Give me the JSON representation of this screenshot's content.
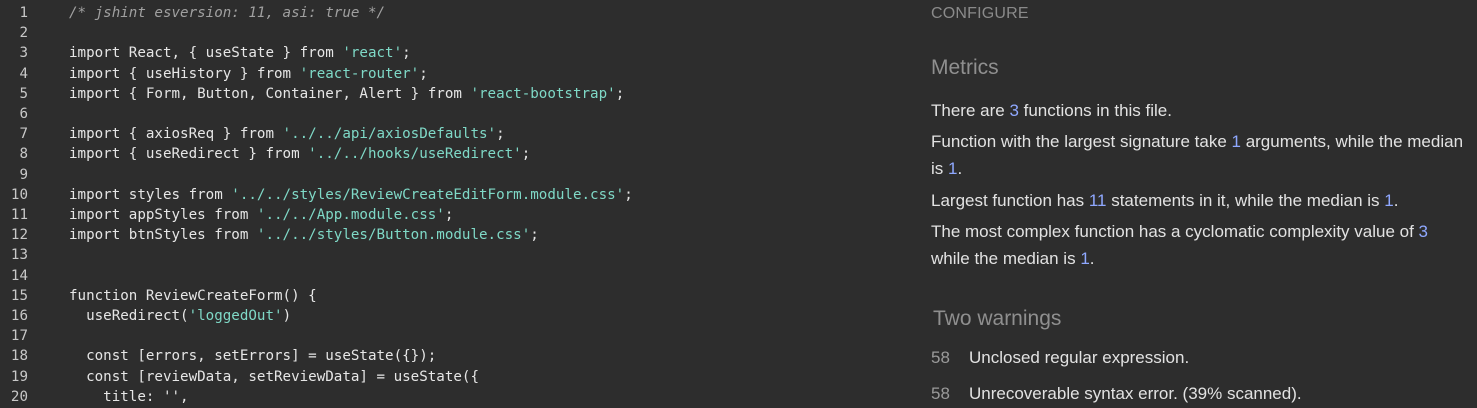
{
  "editor": {
    "lines": [
      {
        "n": "1",
        "t": [
          {
            "k": "comment",
            "v": "/* jshint esversion: 11, asi: true */"
          }
        ]
      },
      {
        "n": "2",
        "t": []
      },
      {
        "n": "3",
        "t": [
          {
            "k": "plain",
            "v": "import React, { useState } from "
          },
          {
            "k": "string",
            "v": "'react'"
          },
          {
            "k": "plain",
            "v": ";"
          }
        ]
      },
      {
        "n": "4",
        "t": [
          {
            "k": "plain",
            "v": "import { useHistory } from "
          },
          {
            "k": "string",
            "v": "'react-router'"
          },
          {
            "k": "plain",
            "v": ";"
          }
        ]
      },
      {
        "n": "5",
        "t": [
          {
            "k": "plain",
            "v": "import { Form, Button, Container, Alert } from "
          },
          {
            "k": "string",
            "v": "'react-bootstrap'"
          },
          {
            "k": "plain",
            "v": ";"
          }
        ]
      },
      {
        "n": "6",
        "t": []
      },
      {
        "n": "7",
        "t": [
          {
            "k": "plain",
            "v": "import { axiosReq } from "
          },
          {
            "k": "string",
            "v": "'../../api/axiosDefaults'"
          },
          {
            "k": "plain",
            "v": ";"
          }
        ]
      },
      {
        "n": "8",
        "t": [
          {
            "k": "plain",
            "v": "import { useRedirect } from "
          },
          {
            "k": "string",
            "v": "'../../hooks/useRedirect'"
          },
          {
            "k": "plain",
            "v": ";"
          }
        ]
      },
      {
        "n": "9",
        "t": []
      },
      {
        "n": "10",
        "t": [
          {
            "k": "plain",
            "v": "import styles from "
          },
          {
            "k": "string",
            "v": "'../../styles/ReviewCreateEditForm.module.css'"
          },
          {
            "k": "plain",
            "v": ";"
          }
        ]
      },
      {
        "n": "11",
        "t": [
          {
            "k": "plain",
            "v": "import appStyles from "
          },
          {
            "k": "string",
            "v": "'../../App.module.css'"
          },
          {
            "k": "plain",
            "v": ";"
          }
        ]
      },
      {
        "n": "12",
        "t": [
          {
            "k": "plain",
            "v": "import btnStyles from "
          },
          {
            "k": "string",
            "v": "'../../styles/Button.module.css'"
          },
          {
            "k": "plain",
            "v": ";"
          }
        ]
      },
      {
        "n": "13",
        "t": []
      },
      {
        "n": "14",
        "t": []
      },
      {
        "n": "15",
        "t": [
          {
            "k": "plain",
            "v": "function ReviewCreateForm() {"
          }
        ]
      },
      {
        "n": "16",
        "t": [
          {
            "k": "plain",
            "v": "  useRedirect("
          },
          {
            "k": "string",
            "v": "'loggedOut'"
          },
          {
            "k": "plain",
            "v": ")"
          }
        ]
      },
      {
        "n": "17",
        "t": []
      },
      {
        "n": "18",
        "t": [
          {
            "k": "plain",
            "v": "  const [errors, setErrors] = useState({});"
          }
        ]
      },
      {
        "n": "19",
        "t": [
          {
            "k": "plain",
            "v": "  const [reviewData, setReviewData] = useState({"
          }
        ]
      },
      {
        "n": "20",
        "t": [
          {
            "k": "plain",
            "v": "    title: '',"
          }
        ]
      }
    ]
  },
  "panel": {
    "configure_label": "CONFIGURE",
    "metrics_title": "Metrics",
    "metrics": [
      [
        {
          "t": "There are "
        },
        {
          "n": "3"
        },
        {
          "t": " functions in this file."
        }
      ],
      [
        {
          "t": "Function with the largest signature take "
        },
        {
          "n": "1"
        },
        {
          "t": " arguments, while the median is "
        },
        {
          "n": "1"
        },
        {
          "t": "."
        }
      ],
      [
        {
          "t": "Largest function has "
        },
        {
          "n": "11"
        },
        {
          "t": " statements in it, while the median is "
        },
        {
          "n": "1"
        },
        {
          "t": "."
        }
      ],
      [
        {
          "t": "The most complex function has a cyclomatic complexity value of "
        },
        {
          "n": "3"
        },
        {
          "t": " while the median is "
        },
        {
          "n": "1"
        },
        {
          "t": "."
        }
      ]
    ],
    "warnings_title": "Two warnings",
    "warnings": [
      {
        "line": "58",
        "text": "Unclosed regular expression."
      },
      {
        "line": "58",
        "text": "Unrecoverable syntax error. (39% scanned)."
      }
    ]
  },
  "colors": {
    "background": "#2d2d2d",
    "string": "#7fd9c7",
    "number_highlight": "#8fa8ff",
    "muted_heading": "#8f8f8f"
  }
}
